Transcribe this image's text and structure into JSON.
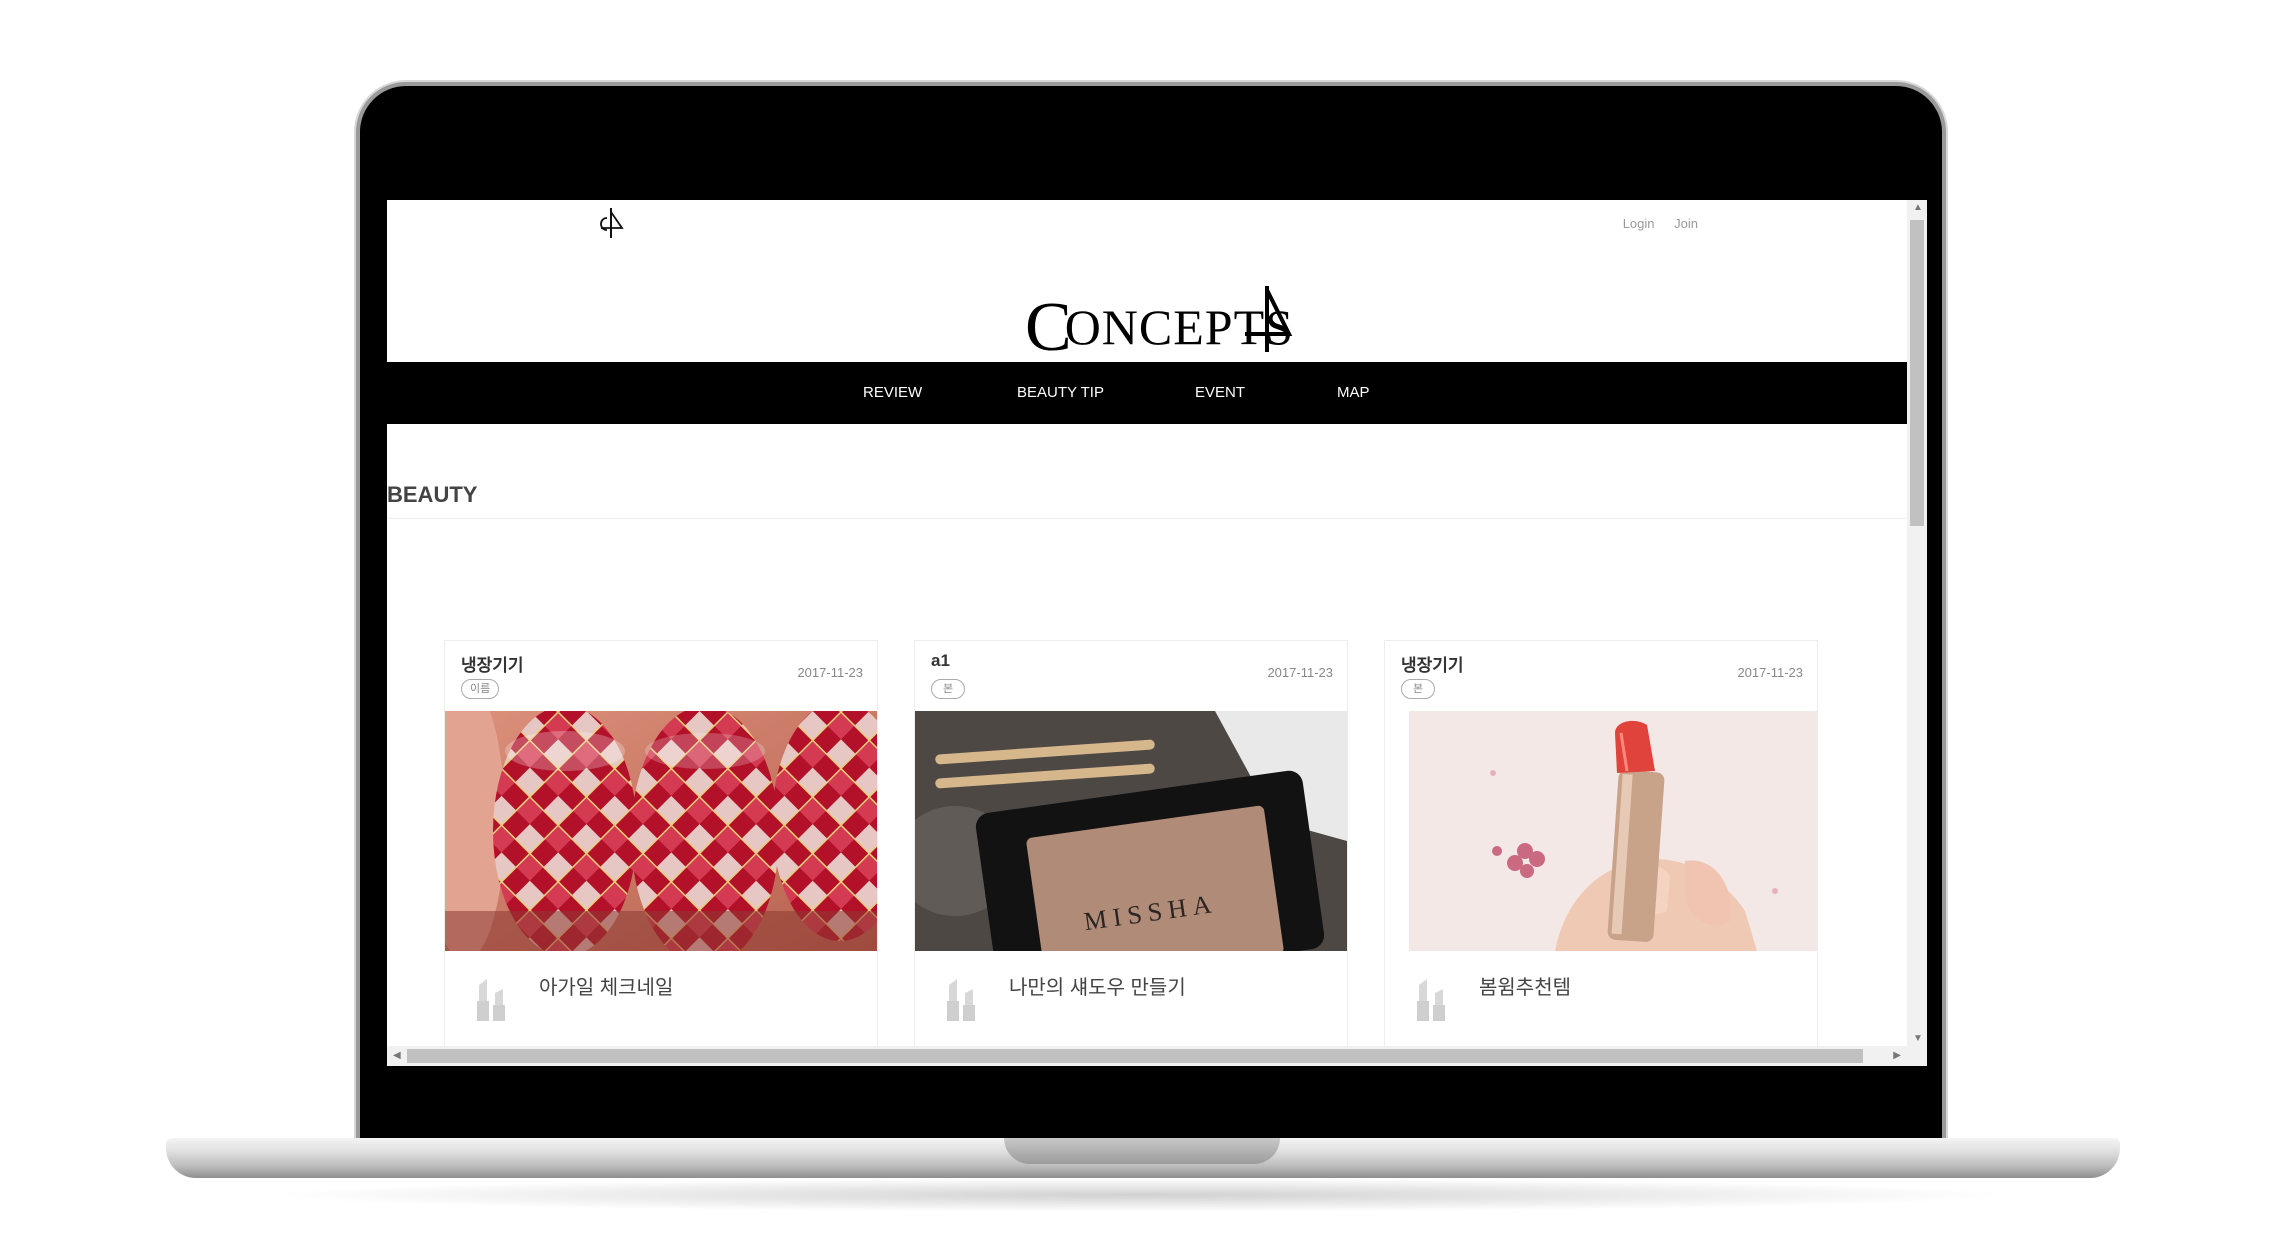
{
  "header": {
    "login_label": "Login",
    "join_label": "Join",
    "brand_initial": "C",
    "brand_rest": "ONCEPTS"
  },
  "nav": {
    "items": [
      {
        "label": "REVIEW"
      },
      {
        "label": "BEAUTY TIP"
      },
      {
        "label": "EVENT"
      },
      {
        "label": "MAP"
      }
    ]
  },
  "section": {
    "title": "BEAUTY"
  },
  "cards": [
    {
      "author": "냉장기기",
      "badge": "이름",
      "date": "2017-11-23",
      "title": "아가일 체크네일",
      "image": "argyle-nail-photo"
    },
    {
      "author": "a1",
      "badge": "본",
      "date": "2017-11-23",
      "title": "나만의 섀도우 만들기",
      "image": "missha-eyeshadow-photo",
      "image_text": "MISSHA"
    },
    {
      "author": "냉장기기",
      "badge": "본",
      "date": "2017-11-23",
      "title": "봄윔추천템",
      "image": "red-lipstick-photo"
    }
  ],
  "icons": {
    "card_icon": "lipstick-icon",
    "mini_logo": "concepts4-mark-icon"
  },
  "colors": {
    "nav_bg": "#000000",
    "laptop_frame": "#000000",
    "text_muted": "#9a9a9a"
  }
}
